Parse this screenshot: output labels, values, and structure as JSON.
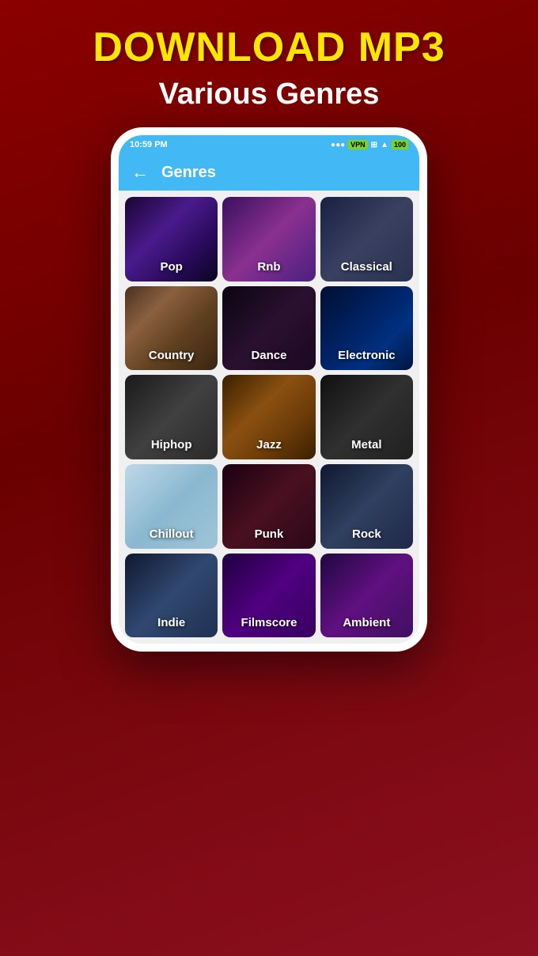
{
  "hero": {
    "title": "DOWNLOAD MP3",
    "subtitle": "Various Genres"
  },
  "statusBar": {
    "time": "10:59 PM",
    "battery": "100",
    "signal": "●●●",
    "vpn": "VPN"
  },
  "topBar": {
    "title": "Genres",
    "backLabel": "←"
  },
  "genres": [
    {
      "id": "pop",
      "label": "Pop",
      "bgClass": "bg-pop"
    },
    {
      "id": "rnb",
      "label": "Rnb",
      "bgClass": "bg-rnb"
    },
    {
      "id": "classical",
      "label": "Classical",
      "bgClass": "bg-classical"
    },
    {
      "id": "country",
      "label": "Country",
      "bgClass": "bg-country"
    },
    {
      "id": "dance",
      "label": "Dance",
      "bgClass": "bg-dance"
    },
    {
      "id": "electronic",
      "label": "Electronic",
      "bgClass": "bg-electronic"
    },
    {
      "id": "hiphop",
      "label": "Hiphop",
      "bgClass": "bg-hiphop"
    },
    {
      "id": "jazz",
      "label": "Jazz",
      "bgClass": "bg-jazz"
    },
    {
      "id": "metal",
      "label": "Metal",
      "bgClass": "bg-metal"
    },
    {
      "id": "chillout",
      "label": "Chillout",
      "bgClass": "bg-chillout"
    },
    {
      "id": "punk",
      "label": "Punk",
      "bgClass": "bg-punk"
    },
    {
      "id": "rock",
      "label": "Rock",
      "bgClass": "bg-rock"
    },
    {
      "id": "indie",
      "label": "Indie",
      "bgClass": "bg-indie"
    },
    {
      "id": "filmscore",
      "label": "Filmscore",
      "bgClass": "bg-filmscore"
    },
    {
      "id": "ambient",
      "label": "Ambient",
      "bgClass": "bg-ambient"
    }
  ]
}
